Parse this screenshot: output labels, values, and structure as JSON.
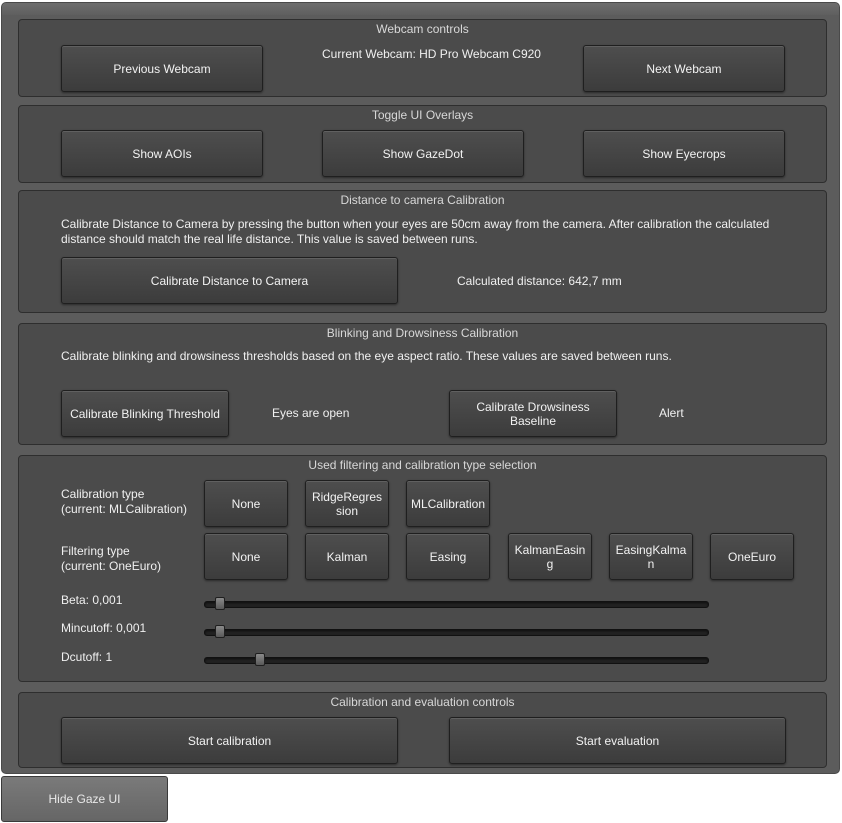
{
  "webcam": {
    "title": "Webcam controls",
    "prev_label": "Previous Webcam",
    "current_label": "Current Webcam: HD Pro Webcam C920",
    "next_label": "Next Webcam"
  },
  "overlays": {
    "title": "Toggle UI Overlays",
    "aois_label": "Show AOIs",
    "gazedot_label": "Show GazeDot",
    "eyecrops_label": "Show Eyecrops"
  },
  "distance": {
    "title": "Distance to camera Calibration",
    "description": "Calibrate Distance to Camera by pressing the button when your eyes are 50cm away from the camera. After calibration the calculated distance should match the real life distance. This value is saved between runs.",
    "button_label": "Calibrate Distance to Camera",
    "result": "Calculated distance: 642,7 mm"
  },
  "blink": {
    "title": "Blinking and Drowsiness Calibration",
    "description": "Calibrate blinking and drowsiness thresholds based on the eye aspect ratio. These values are saved between runs.",
    "blink_button": "Calibrate Blinking Threshold",
    "blink_status": "Eyes are open",
    "drowsy_button": "Calibrate Drowsiness Baseline",
    "drowsy_status": "Alert"
  },
  "filtering": {
    "title": "Used filtering and calibration type selection",
    "calib_type_label": "Calibration type",
    "calib_type_current": "(current: MLCalibration)",
    "calib_options": [
      "None",
      "RidgeRegression",
      "MLCalibration"
    ],
    "filter_type_label": "Filtering type",
    "filter_type_current": "(current: OneEuro)",
    "filter_options": [
      "None",
      "Kalman",
      "Easing",
      "KalmanEasing",
      "EasingKalman",
      "OneEuro"
    ],
    "beta_label": "Beta: 0,001",
    "beta_value": 0.001,
    "mincutoff_label": "Mincutoff: 0,001",
    "mincutoff_value": 0.001,
    "dcutoff_label": "Dcutoff: 1",
    "dcutoff_value": 1
  },
  "evaluation": {
    "title": "Calibration and evaluation controls",
    "start_calibration": "Start calibration",
    "start_evaluation": "Start evaluation"
  },
  "hide_label": "Hide Gaze UI"
}
